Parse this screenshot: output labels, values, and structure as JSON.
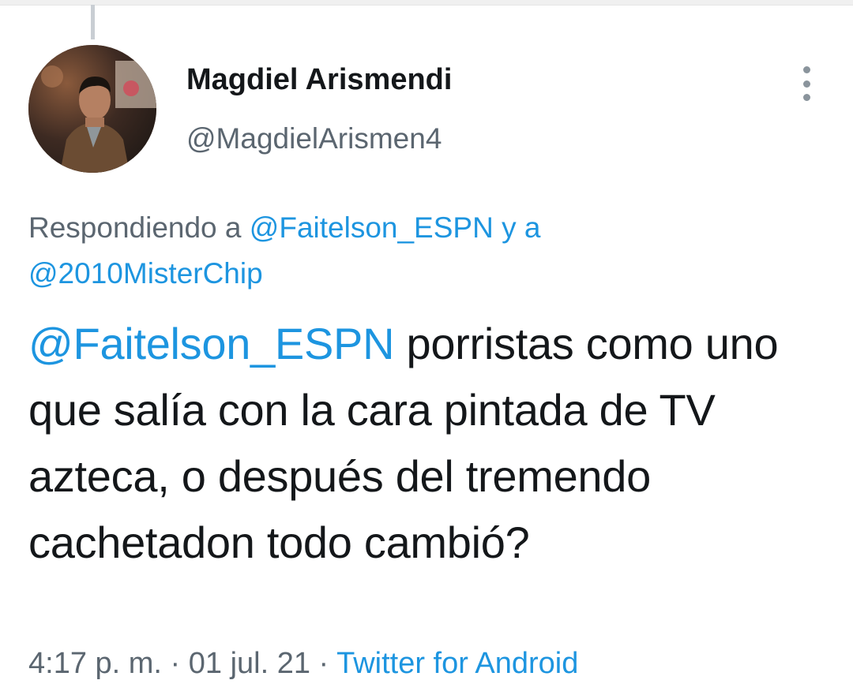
{
  "tweet": {
    "display_name": "Magdiel Arismendi",
    "handle": "@MagdielArismen4",
    "replying": {
      "prefix": "Respondiendo a ",
      "mention1": "@Faitelson_ESPN",
      "joiner": " y a",
      "mention2": "@2010MisterChip"
    },
    "body": {
      "mention": "@Faitelson_ESPN",
      "text": " porristas como uno que salía con la cara pintada de TV azteca, o después del tremendo cachetadon todo cambió?"
    },
    "meta": {
      "time": "4:17 p. m.",
      "separator1": " · ",
      "date": "01 jul. 21",
      "separator2": " · ",
      "source": "Twitter for Android"
    }
  },
  "icons": {
    "more": "more-vertical-icon"
  },
  "colors": {
    "link": "#1d95e0",
    "muted": "#5b6670",
    "text": "#14171a"
  }
}
